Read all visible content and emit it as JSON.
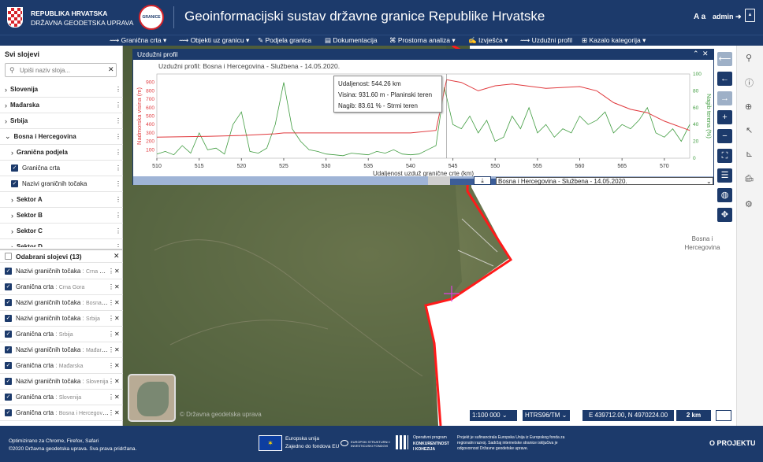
{
  "header": {
    "org_line1": "REPUBLIKA HRVATSKA",
    "org_line2": "DRŽAVNA GEODETSKA UPRAVA",
    "badge_text": "GRANICE",
    "title": "Geoinformacijski sustav državne granice Republike Hrvatske",
    "font_size_label": "A a",
    "user": "admin"
  },
  "nav": [
    {
      "label": "Granična crta ▾"
    },
    {
      "label": "Objekti uz granicu ▾"
    },
    {
      "label": "Podjela granica"
    },
    {
      "label": "Dokumentacija"
    },
    {
      "label": "Prostorna analiza ▾"
    },
    {
      "label": "Izvješća ▾"
    },
    {
      "label": "Uzdužni profil"
    },
    {
      "label": "Kazalo kategorija ▾"
    }
  ],
  "sidebar": {
    "all_layers_title": "Svi slojevi",
    "search_placeholder": "Upiši naziv sloja...",
    "layers": [
      {
        "label": "Slovenija"
      },
      {
        "label": "Mađarska"
      },
      {
        "label": "Srbija"
      },
      {
        "label": "Bosna i Hercegovina"
      },
      {
        "label": "Granična podjela"
      },
      {
        "label": "Granična crta"
      },
      {
        "label": "Nazivi graničnih točaka"
      },
      {
        "label": "Sektor A"
      },
      {
        "label": "Sektor B"
      },
      {
        "label": "Sektor C"
      },
      {
        "label": "Sektor D"
      }
    ],
    "selected_title": "Odabrani slojevi (13)",
    "selected": [
      {
        "name": "Nazivi graničnih točaka",
        "group": "Crna Gora"
      },
      {
        "name": "Granična crta",
        "group": "Crna Gora"
      },
      {
        "name": "Nazivi graničnih točaka",
        "group": "Bosna i Hercegovina"
      },
      {
        "name": "Nazivi graničnih točaka",
        "group": "Srbija"
      },
      {
        "name": "Granična crta",
        "group": "Srbija"
      },
      {
        "name": "Nazivi graničnih točaka",
        "group": "Mađarska"
      },
      {
        "name": "Granična crta",
        "group": "Mađarska"
      },
      {
        "name": "Nazivi graničnih točaka",
        "group": "Slovenija"
      },
      {
        "name": "Granična crta",
        "group": "Slovenija"
      },
      {
        "name": "Granična crta",
        "group": "Bosna i Hercegovina"
      }
    ]
  },
  "profile": {
    "panel_title": "Uzdužni profil",
    "chart_title": "Uzdužni profil: Bosna i Hercegovina - Službena - 14.05.2020.",
    "tooltip_distance": "Udaljenost: 544.26 km",
    "tooltip_height": "Visina: 931.60 m - Planinski teren",
    "tooltip_slope": "Nagib: 83.61 % - Strmi teren",
    "select_value": "Bosna i Hercegovina - Službena - 14.05.2020."
  },
  "chart_data": {
    "type": "line",
    "xlabel": "Udaljenost uzduž granične crte (km)",
    "ylabel_left": "Nadmorska visina (m)",
    "ylabel_right": "Nagib terena (%)",
    "xlim": [
      510,
      573
    ],
    "xticks": [
      510,
      515,
      520,
      525,
      530,
      535,
      540,
      545,
      550,
      555,
      560,
      565,
      570
    ],
    "ylim_left": [
      0,
      1000
    ],
    "yticks_left": [
      100,
      200,
      300,
      400,
      500,
      600,
      700,
      800,
      900
    ],
    "ylim_right": [
      0,
      100
    ],
    "yticks_right": [
      0,
      20,
      40,
      60,
      80,
      100
    ],
    "series": [
      {
        "name": "Nadmorska visina (m)",
        "color": "#e0383c",
        "x": [
          510,
          516,
          520,
          524,
          525,
          526,
          530,
          535,
          540,
          543,
          544.26,
          546,
          548,
          550,
          552,
          556,
          560,
          562,
          564,
          566,
          568,
          570,
          573
        ],
        "y": [
          250,
          260,
          270,
          290,
          300,
          300,
          300,
          300,
          300,
          330,
          931.6,
          900,
          800,
          860,
          880,
          830,
          850,
          800,
          660,
          580,
          540,
          440,
          330
        ]
      },
      {
        "name": "Nagib terena (%)",
        "color": "#3e9b3e",
        "x": [
          510,
          511,
          512,
          513,
          514,
          515,
          516,
          517,
          518,
          519,
          520,
          521,
          522,
          523,
          524,
          525,
          526,
          527,
          528,
          529,
          530,
          531,
          532,
          533,
          534,
          535,
          536,
          537,
          538,
          539,
          540,
          541,
          542,
          543,
          544,
          545,
          546,
          547,
          548,
          549,
          550,
          551,
          552,
          553,
          554,
          555,
          556,
          557,
          558,
          559,
          560,
          561,
          562,
          563,
          564,
          565,
          566,
          567,
          568,
          569,
          570,
          571,
          572,
          573
        ],
        "y": [
          5,
          8,
          4,
          15,
          6,
          30,
          10,
          12,
          5,
          40,
          55,
          8,
          6,
          12,
          40,
          90,
          35,
          20,
          10,
          8,
          5,
          4,
          3,
          6,
          5,
          4,
          8,
          6,
          10,
          5,
          4,
          5,
          10,
          15,
          84,
          40,
          35,
          50,
          30,
          45,
          20,
          25,
          50,
          35,
          60,
          30,
          40,
          25,
          35,
          30,
          50,
          40,
          45,
          55,
          30,
          40,
          35,
          45,
          60,
          30,
          25,
          35,
          20,
          40
        ]
      }
    ]
  },
  "map": {
    "label_country": "Bosna i Hercegovina",
    "copyright": "© Državna geodetska uprava",
    "scale": "1:100 000",
    "crs": "HTRS96/TM",
    "coords": "E 439712.00, N 4970224.00",
    "scalebar": "2 km"
  },
  "footer": {
    "browsers": "Optimizirano za Chrome, Firefox, Safari",
    "copyright": "©2020 Državna geodetska uprava. Sva prava pridržana.",
    "eu_line1": "Europska unija",
    "eu_line2": "Zajedno do fondova EU",
    "esif": "EUROPSKI STRUKTURNI I INVESTICIJSKI FONDOVI",
    "op_line1": "Operativni program",
    "op_line2": "KONKURENTNOST",
    "op_line3": "I KOHEZIJA",
    "project_note": "Projekt je sufinancirala Europska Unija iz Europskog fonda za regionalni razvoj. Sadržaj internetske stranice isključiva je odgovornost Državne geodetske uprave.",
    "about": "O PROJEKTU"
  },
  "colors": {
    "brand": "#1c3a6b",
    "border_line": "#ff1a1a",
    "elevation": "#e0383c",
    "slope": "#3e9b3e"
  }
}
